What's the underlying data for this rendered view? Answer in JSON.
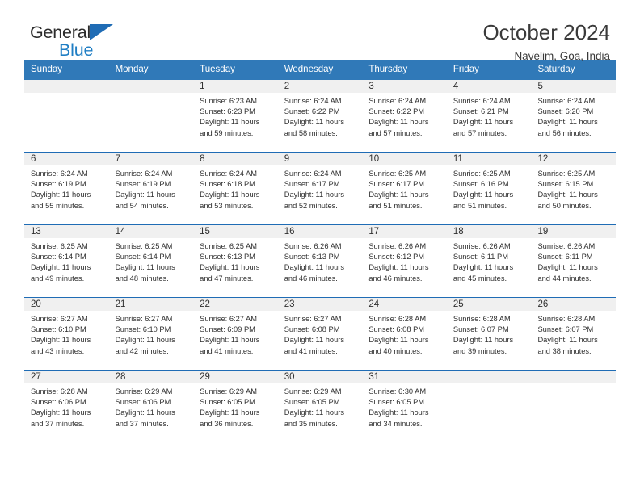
{
  "brand": {
    "name_top": "General",
    "name_bottom": "Blue",
    "triangle_color": "#1f6cb5",
    "text_color": "#2b2b2b",
    "blue_color": "#1f7ec4"
  },
  "header": {
    "title": "October 2024",
    "subtitle": "Navelim, Goa, India"
  },
  "theme": {
    "header_bg": "#3079b8",
    "row_line": "#1f6cb5",
    "date_bar_bg": "#f0f0f0",
    "text": "#2f2f2f"
  },
  "weekdays": [
    "Sunday",
    "Monday",
    "Tuesday",
    "Wednesday",
    "Thursday",
    "Friday",
    "Saturday"
  ],
  "labels": {
    "sunrise_prefix": "Sunrise:",
    "sunset_prefix": "Sunset:",
    "daylight_prefix": "Daylight:"
  },
  "weeks": [
    [
      {
        "date": "",
        "sunrise": "",
        "sunset": "",
        "daylight_1": "",
        "daylight_2": ""
      },
      {
        "date": "",
        "sunrise": "",
        "sunset": "",
        "daylight_1": "",
        "daylight_2": ""
      },
      {
        "date": "1",
        "sunrise": "Sunrise: 6:23 AM",
        "sunset": "Sunset: 6:23 PM",
        "daylight_1": "Daylight: 11 hours",
        "daylight_2": "and 59 minutes."
      },
      {
        "date": "2",
        "sunrise": "Sunrise: 6:24 AM",
        "sunset": "Sunset: 6:22 PM",
        "daylight_1": "Daylight: 11 hours",
        "daylight_2": "and 58 minutes."
      },
      {
        "date": "3",
        "sunrise": "Sunrise: 6:24 AM",
        "sunset": "Sunset: 6:22 PM",
        "daylight_1": "Daylight: 11 hours",
        "daylight_2": "and 57 minutes."
      },
      {
        "date": "4",
        "sunrise": "Sunrise: 6:24 AM",
        "sunset": "Sunset: 6:21 PM",
        "daylight_1": "Daylight: 11 hours",
        "daylight_2": "and 57 minutes."
      },
      {
        "date": "5",
        "sunrise": "Sunrise: 6:24 AM",
        "sunset": "Sunset: 6:20 PM",
        "daylight_1": "Daylight: 11 hours",
        "daylight_2": "and 56 minutes."
      }
    ],
    [
      {
        "date": "6",
        "sunrise": "Sunrise: 6:24 AM",
        "sunset": "Sunset: 6:19 PM",
        "daylight_1": "Daylight: 11 hours",
        "daylight_2": "and 55 minutes."
      },
      {
        "date": "7",
        "sunrise": "Sunrise: 6:24 AM",
        "sunset": "Sunset: 6:19 PM",
        "daylight_1": "Daylight: 11 hours",
        "daylight_2": "and 54 minutes."
      },
      {
        "date": "8",
        "sunrise": "Sunrise: 6:24 AM",
        "sunset": "Sunset: 6:18 PM",
        "daylight_1": "Daylight: 11 hours",
        "daylight_2": "and 53 minutes."
      },
      {
        "date": "9",
        "sunrise": "Sunrise: 6:24 AM",
        "sunset": "Sunset: 6:17 PM",
        "daylight_1": "Daylight: 11 hours",
        "daylight_2": "and 52 minutes."
      },
      {
        "date": "10",
        "sunrise": "Sunrise: 6:25 AM",
        "sunset": "Sunset: 6:17 PM",
        "daylight_1": "Daylight: 11 hours",
        "daylight_2": "and 51 minutes."
      },
      {
        "date": "11",
        "sunrise": "Sunrise: 6:25 AM",
        "sunset": "Sunset: 6:16 PM",
        "daylight_1": "Daylight: 11 hours",
        "daylight_2": "and 51 minutes."
      },
      {
        "date": "12",
        "sunrise": "Sunrise: 6:25 AM",
        "sunset": "Sunset: 6:15 PM",
        "daylight_1": "Daylight: 11 hours",
        "daylight_2": "and 50 minutes."
      }
    ],
    [
      {
        "date": "13",
        "sunrise": "Sunrise: 6:25 AM",
        "sunset": "Sunset: 6:14 PM",
        "daylight_1": "Daylight: 11 hours",
        "daylight_2": "and 49 minutes."
      },
      {
        "date": "14",
        "sunrise": "Sunrise: 6:25 AM",
        "sunset": "Sunset: 6:14 PM",
        "daylight_1": "Daylight: 11 hours",
        "daylight_2": "and 48 minutes."
      },
      {
        "date": "15",
        "sunrise": "Sunrise: 6:25 AM",
        "sunset": "Sunset: 6:13 PM",
        "daylight_1": "Daylight: 11 hours",
        "daylight_2": "and 47 minutes."
      },
      {
        "date": "16",
        "sunrise": "Sunrise: 6:26 AM",
        "sunset": "Sunset: 6:13 PM",
        "daylight_1": "Daylight: 11 hours",
        "daylight_2": "and 46 minutes."
      },
      {
        "date": "17",
        "sunrise": "Sunrise: 6:26 AM",
        "sunset": "Sunset: 6:12 PM",
        "daylight_1": "Daylight: 11 hours",
        "daylight_2": "and 46 minutes."
      },
      {
        "date": "18",
        "sunrise": "Sunrise: 6:26 AM",
        "sunset": "Sunset: 6:11 PM",
        "daylight_1": "Daylight: 11 hours",
        "daylight_2": "and 45 minutes."
      },
      {
        "date": "19",
        "sunrise": "Sunrise: 6:26 AM",
        "sunset": "Sunset: 6:11 PM",
        "daylight_1": "Daylight: 11 hours",
        "daylight_2": "and 44 minutes."
      }
    ],
    [
      {
        "date": "20",
        "sunrise": "Sunrise: 6:27 AM",
        "sunset": "Sunset: 6:10 PM",
        "daylight_1": "Daylight: 11 hours",
        "daylight_2": "and 43 minutes."
      },
      {
        "date": "21",
        "sunrise": "Sunrise: 6:27 AM",
        "sunset": "Sunset: 6:10 PM",
        "daylight_1": "Daylight: 11 hours",
        "daylight_2": "and 42 minutes."
      },
      {
        "date": "22",
        "sunrise": "Sunrise: 6:27 AM",
        "sunset": "Sunset: 6:09 PM",
        "daylight_1": "Daylight: 11 hours",
        "daylight_2": "and 41 minutes."
      },
      {
        "date": "23",
        "sunrise": "Sunrise: 6:27 AM",
        "sunset": "Sunset: 6:08 PM",
        "daylight_1": "Daylight: 11 hours",
        "daylight_2": "and 41 minutes."
      },
      {
        "date": "24",
        "sunrise": "Sunrise: 6:28 AM",
        "sunset": "Sunset: 6:08 PM",
        "daylight_1": "Daylight: 11 hours",
        "daylight_2": "and 40 minutes."
      },
      {
        "date": "25",
        "sunrise": "Sunrise: 6:28 AM",
        "sunset": "Sunset: 6:07 PM",
        "daylight_1": "Daylight: 11 hours",
        "daylight_2": "and 39 minutes."
      },
      {
        "date": "26",
        "sunrise": "Sunrise: 6:28 AM",
        "sunset": "Sunset: 6:07 PM",
        "daylight_1": "Daylight: 11 hours",
        "daylight_2": "and 38 minutes."
      }
    ],
    [
      {
        "date": "27",
        "sunrise": "Sunrise: 6:28 AM",
        "sunset": "Sunset: 6:06 PM",
        "daylight_1": "Daylight: 11 hours",
        "daylight_2": "and 37 minutes."
      },
      {
        "date": "28",
        "sunrise": "Sunrise: 6:29 AM",
        "sunset": "Sunset: 6:06 PM",
        "daylight_1": "Daylight: 11 hours",
        "daylight_2": "and 37 minutes."
      },
      {
        "date": "29",
        "sunrise": "Sunrise: 6:29 AM",
        "sunset": "Sunset: 6:05 PM",
        "daylight_1": "Daylight: 11 hours",
        "daylight_2": "and 36 minutes."
      },
      {
        "date": "30",
        "sunrise": "Sunrise: 6:29 AM",
        "sunset": "Sunset: 6:05 PM",
        "daylight_1": "Daylight: 11 hours",
        "daylight_2": "and 35 minutes."
      },
      {
        "date": "31",
        "sunrise": "Sunrise: 6:30 AM",
        "sunset": "Sunset: 6:05 PM",
        "daylight_1": "Daylight: 11 hours",
        "daylight_2": "and 34 minutes."
      },
      {
        "date": "",
        "sunrise": "",
        "sunset": "",
        "daylight_1": "",
        "daylight_2": ""
      },
      {
        "date": "",
        "sunrise": "",
        "sunset": "",
        "daylight_1": "",
        "daylight_2": ""
      }
    ]
  ]
}
